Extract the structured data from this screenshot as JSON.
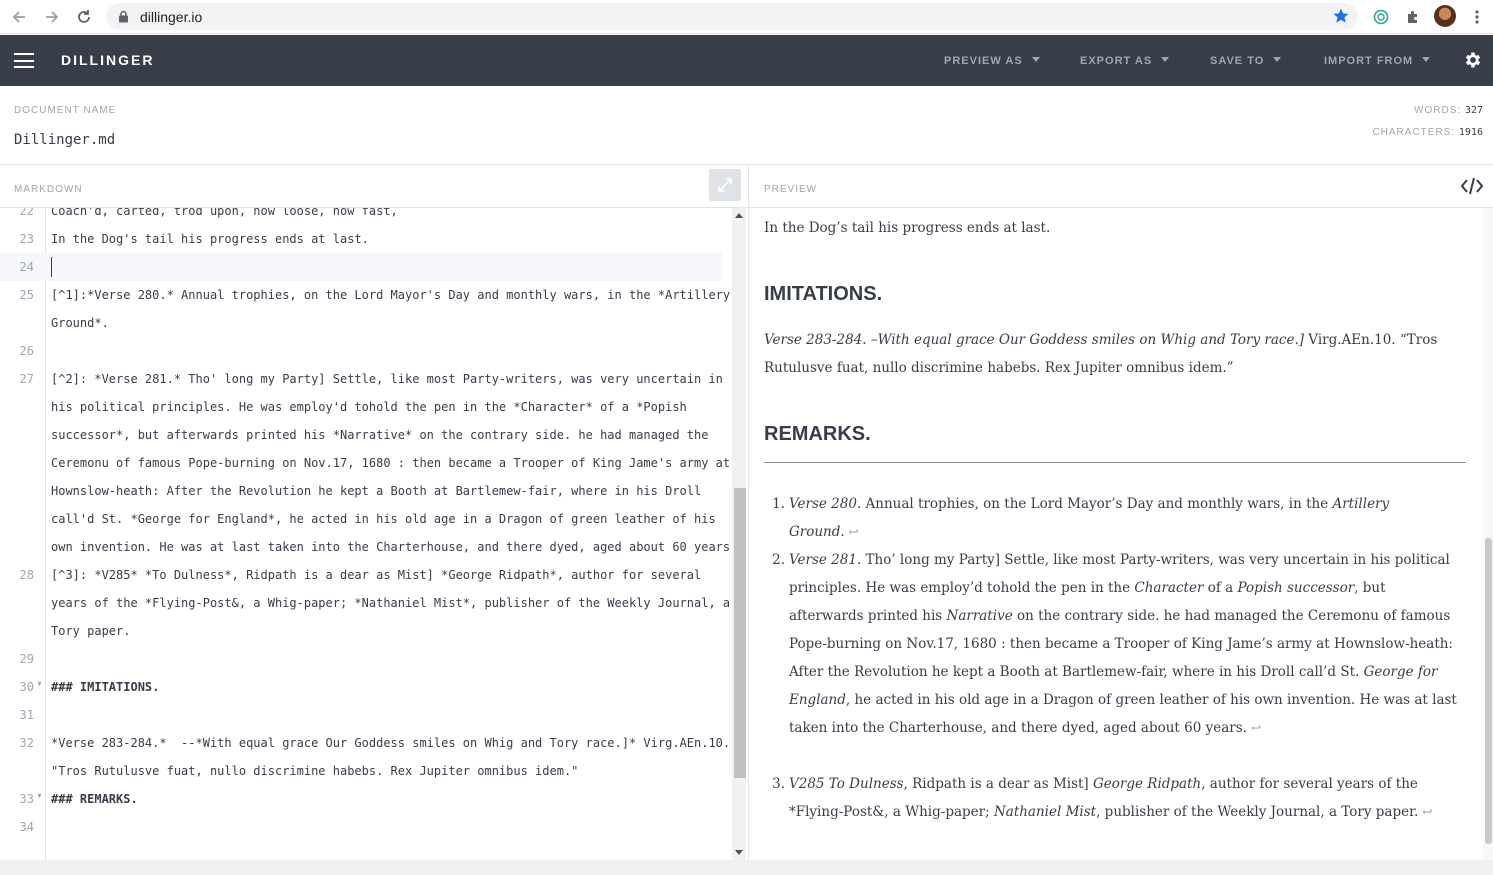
{
  "browser": {
    "url": "dillinger.io"
  },
  "app": {
    "brand": "DILLINGER",
    "menus": [
      "PREVIEW AS",
      "EXPORT AS",
      "SAVE TO",
      "IMPORT FROM"
    ]
  },
  "document": {
    "label": "DOCUMENT NAME",
    "name": "Dillinger.md",
    "words_label": "WORDS:",
    "words": "327",
    "chars_label": "CHARACTERS:",
    "chars": "1916"
  },
  "editor": {
    "label": "MARKDOWN",
    "lines": [
      {
        "n": "22",
        "text": "Coach'd, carted, trod upon, now loose, now fast,"
      },
      {
        "n": "23",
        "text": "In the Dog's tail his progress ends at last."
      },
      {
        "n": "24",
        "text": ""
      },
      {
        "n": "25",
        "text": "[^1]:*Verse 280.* Annual trophies, on the Lord Mayor's Day and monthly wars, in the *Artillery"
      },
      {
        "n": "",
        "text": "Ground*."
      },
      {
        "n": "26",
        "text": ""
      },
      {
        "n": "27",
        "text": "[^2]: *Verse 281.* Tho' long my Party] Settle, like most Party-writers, was very uncertain in"
      },
      {
        "n": "",
        "text": "his political principles. He was employ'd tohold the pen in the *Character* of a *Popish"
      },
      {
        "n": "",
        "text": "successor*, but afterwards printed his *Narrative* on the contrary side. he had managed the"
      },
      {
        "n": "",
        "text": "Ceremonu of famous Pope-burning on Nov.17, 1680 : then became a Trooper of King Jame's army at"
      },
      {
        "n": "",
        "text": "Hownslow-heath: After the Revolution he kept a Booth at Bartlemew-fair, where in his Droll"
      },
      {
        "n": "",
        "text": "call'd St. *George for England*, he acted in his old age in a Dragon of green leather of his"
      },
      {
        "n": "",
        "text": "own invention. He was at last taken into the Charterhouse, and there dyed, aged about 60 years."
      },
      {
        "n": "28",
        "text": "[^3]: *V285* *To Dulness*, Ridpath is a dear as Mist] *George Ridpath*, author for several"
      },
      {
        "n": "",
        "text": "years of the *Flying-Post&, a Whig-paper; *Nathaniel Mist*, publisher of the Weekly Journal, a"
      },
      {
        "n": "",
        "text": "Tory paper."
      },
      {
        "n": "29",
        "text": ""
      },
      {
        "n": "30",
        "text": "### IMITATIONS."
      },
      {
        "n": "31",
        "text": ""
      },
      {
        "n": "32",
        "text": "*Verse 283-284.*  --*With equal grace Our Goddess smiles on Whig and Tory race.]* Virg.AEn.10."
      },
      {
        "n": "",
        "text": "\"Tros Rutulusve fuat, nullo discrimine habebs. Rex Jupiter omnibus idem.\""
      },
      {
        "n": "33",
        "text": "### REMARKS."
      },
      {
        "n": "34",
        "text": ""
      }
    ]
  },
  "preview": {
    "label": "PREVIEW",
    "top_line": "In the Dog’s tail his progress ends at last.",
    "h_imitations": "IMITATIONS.",
    "imit_italic": "Verse 283-284. –With equal grace Our Goddess smiles on Whig and Tory race.]",
    "imit_rest": " Virg.AEn.10. “Tros Rutulusve fuat, nullo discrimine habebs. Rex Jupiter omnibus idem.”",
    "h_remarks": "REMARKS.",
    "fn1": {
      "num": "1.",
      "a_i": "Verse 280",
      "b": ". Annual trophies, on the Lord Mayor’s Day and monthly wars, in the ",
      "c_i": "Artillery Ground",
      "d": "."
    },
    "fn2": {
      "num": "2.",
      "a_i": "Verse 281",
      "b": ". Tho’ long my Party] Settle, like most Party-writers, was very uncertain in his political principles. He was employ’d tohold the pen in the ",
      "c_i": "Character",
      "d": " of a ",
      "e_i": "Popish successor",
      "f": ", but afterwards printed his ",
      "g_i": "Narrative",
      "h": " on the contrary side. he had managed the Ceremonu of famous Pope-burning on Nov.17, 1680 : then became a Trooper of King Jame’s army at Hownslow-heath: After the Revolution he kept a Booth at Bartlemew-fair, where in his Droll call’d St. ",
      "i_i": "George for England",
      "j": ", he acted in his old age in a Dragon of green leather of his own invention. He was at last taken into the Charterhouse, and there dyed, aged about 60 years."
    },
    "fn3": {
      "num": "3.",
      "a_i": "V285 To Dulness",
      "b": ", Ridpath is a dear as Mist] ",
      "c_i": "George Ridpath",
      "d": ", author for several years of the *Flying-Post&, a Whig-paper; ",
      "e_i": "Nathaniel Mist",
      "f": ", publisher of the Weekly Journal, a Tory paper."
    },
    "backref": "↩"
  },
  "colors": {
    "appbar": "#373d49",
    "text": "#373d49",
    "muted": "#a0a6b1",
    "star": "#1a73e8"
  }
}
